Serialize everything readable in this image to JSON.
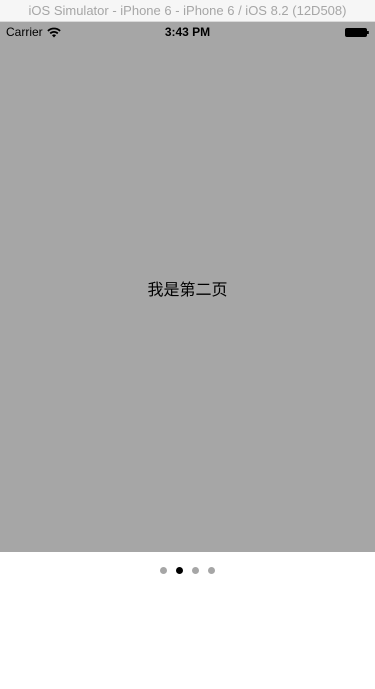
{
  "simulator": {
    "title": "iOS Simulator - iPhone 6 - iPhone 6 / iOS 8.2 (12D508)"
  },
  "status_bar": {
    "carrier": "Carrier",
    "time": "3:43 PM",
    "icons": [
      "wifi-icon",
      "battery-icon"
    ]
  },
  "page": {
    "label": "我是第二页",
    "background_color": "#a6a6a6"
  },
  "page_control": {
    "page_count": 4,
    "current_page": 2,
    "active_color": "#000000",
    "inactive_color": "#a6a6a6"
  }
}
